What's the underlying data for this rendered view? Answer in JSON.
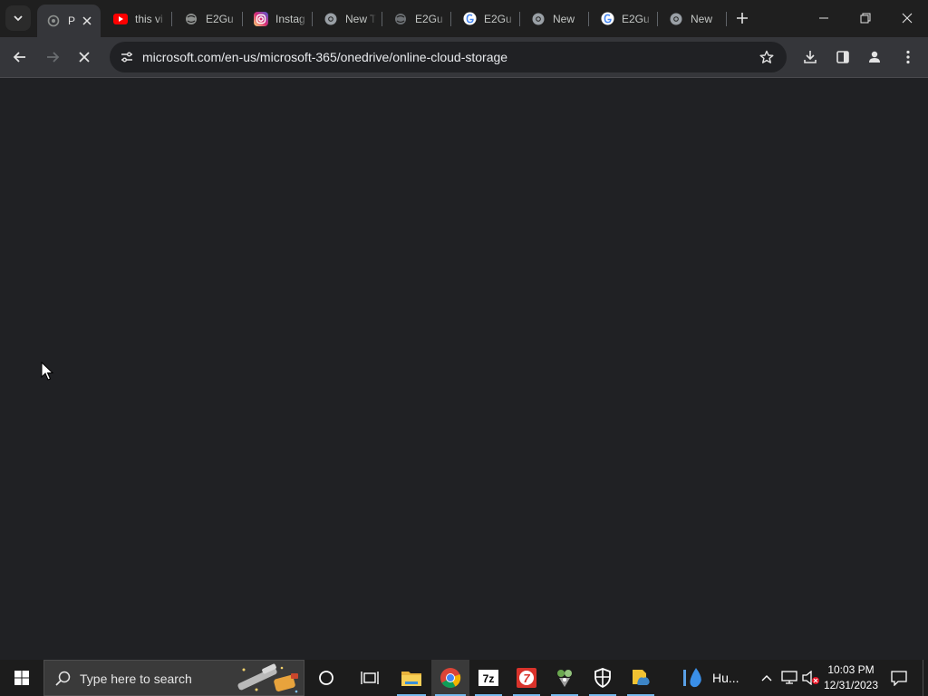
{
  "browser": {
    "tabs": [
      {
        "title": "P",
        "icon": "onedrive-loading-icon",
        "active": true
      },
      {
        "title": "this vi",
        "icon": "youtube-icon",
        "active": false
      },
      {
        "title": "E2Gu",
        "icon": "globe-icon",
        "active": false
      },
      {
        "title": "Instag",
        "icon": "instagram-icon",
        "active": false
      },
      {
        "title": "New T",
        "icon": "chrome-icon",
        "active": false
      },
      {
        "title": "E2Gu",
        "icon": "globe-icon",
        "active": false
      },
      {
        "title": "E2Gu",
        "icon": "google-icon",
        "active": false
      },
      {
        "title": "New",
        "icon": "chrome-icon",
        "active": false
      },
      {
        "title": "E2Gu",
        "icon": "google-icon",
        "active": false
      },
      {
        "title": "New",
        "icon": "chrome-icon",
        "active": false
      }
    ],
    "address_bar": {
      "url": "microsoft.com/en-us/microsoft-365/onedrive/online-cloud-storage"
    },
    "page_state": "loading"
  },
  "taskbar": {
    "search_placeholder": "Type here to search",
    "pinned": [
      {
        "name": "cortana",
        "icon": "circle-icon"
      },
      {
        "name": "task-view",
        "icon": "task-view-icon"
      },
      {
        "name": "file-explorer",
        "icon": "folder-icon"
      },
      {
        "name": "chrome",
        "icon": "chrome-icon"
      },
      {
        "name": "7zip",
        "icon": "7zip-icon"
      },
      {
        "name": "app-red",
        "icon": "app-icon"
      },
      {
        "name": "app-game",
        "icon": "game-icon"
      },
      {
        "name": "security",
        "icon": "shield-icon"
      },
      {
        "name": "files",
        "icon": "files-icon"
      }
    ],
    "weather_text": "Hu...",
    "clock": {
      "time": "10:03 PM",
      "date": "12/31/2023"
    }
  },
  "colors": {
    "tabstrip_bg": "#1f1f1f",
    "active_tab_bg": "#35363a",
    "content_bg": "#202124",
    "taskbar_bg": "#1c1c1c",
    "taskbar_running_accent": "#76b9ed"
  }
}
